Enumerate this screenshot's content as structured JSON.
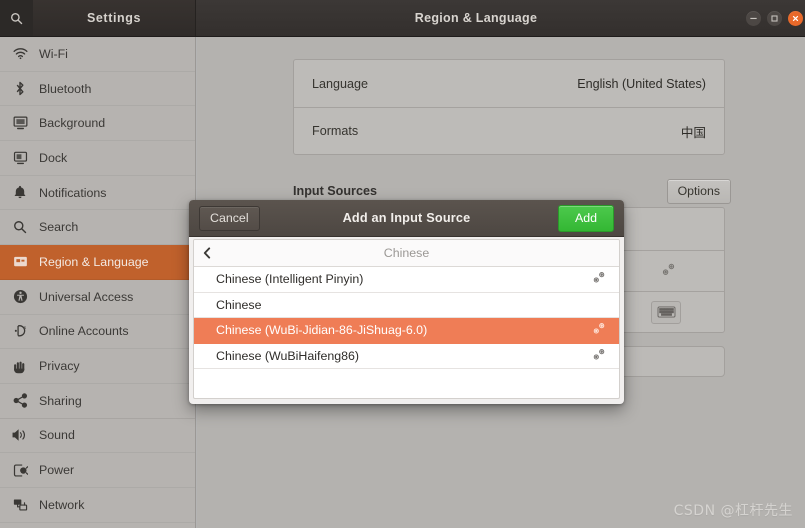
{
  "window": {
    "left_title": "Settings",
    "main_title": "Region & Language",
    "search_icon": "search-icon",
    "controls": {
      "minimize": "minimize-icon",
      "maximize": "maximize-icon",
      "close": "close-icon"
    }
  },
  "sidebar": {
    "items": [
      {
        "label": "Wi-Fi",
        "icon": "wifi-icon",
        "selected": false
      },
      {
        "label": "Bluetooth",
        "icon": "bluetooth-icon",
        "selected": false
      },
      {
        "label": "Background",
        "icon": "background-monitor-icon",
        "selected": false
      },
      {
        "label": "Dock",
        "icon": "dock-icon",
        "selected": false
      },
      {
        "label": "Notifications",
        "icon": "bell-icon",
        "selected": false
      },
      {
        "label": "Search",
        "icon": "search-icon",
        "selected": false
      },
      {
        "label": "Region & Language",
        "icon": "region-language-icon",
        "selected": true
      },
      {
        "label": "Universal Access",
        "icon": "accessibility-icon",
        "selected": false
      },
      {
        "label": "Online Accounts",
        "icon": "online-accounts-icon",
        "selected": false
      },
      {
        "label": "Privacy",
        "icon": "privacy-hand-icon",
        "selected": false
      },
      {
        "label": "Sharing",
        "icon": "share-icon",
        "selected": false
      },
      {
        "label": "Sound",
        "icon": "sound-speaker-icon",
        "selected": false
      },
      {
        "label": "Power",
        "icon": "power-battery-icon",
        "selected": false
      },
      {
        "label": "Network",
        "icon": "network-icon",
        "selected": false
      }
    ]
  },
  "main": {
    "language_panel": {
      "rows": [
        {
          "label": "Language",
          "value": "English (United States)"
        },
        {
          "label": "Formats",
          "value": "中国"
        }
      ]
    },
    "input_sources": {
      "section_label": "Input Sources",
      "options_button": "Options",
      "row_icons": [
        "preferences-gear-icon",
        "preferences-gear-icon",
        "keyboard-icon"
      ]
    }
  },
  "dialog": {
    "title": "Add an Input Source",
    "cancel_label": "Cancel",
    "add_label": "Add",
    "back_icon": "chevron-left-icon",
    "list_header": "Chinese",
    "rows": [
      {
        "label": "Chinese (Intelligent Pinyin)",
        "gear": true,
        "highlighted": false
      },
      {
        "label": "Chinese",
        "gear": false,
        "highlighted": false
      },
      {
        "label": "Chinese (WuBi-Jidian-86-JiShuag-6.0)",
        "gear": true,
        "highlighted": true
      },
      {
        "label": "Chinese (WuBiHaifeng86)",
        "gear": true,
        "highlighted": false
      }
    ]
  },
  "watermark": {
    "text": "CSDN @杠杆先生"
  },
  "colors": {
    "selected_sidebar": "#c0612c",
    "list_highlight": "#ef7d56",
    "add_button": "#34b734",
    "close_button": "#e8692a",
    "titlebar": "#3c3836"
  }
}
